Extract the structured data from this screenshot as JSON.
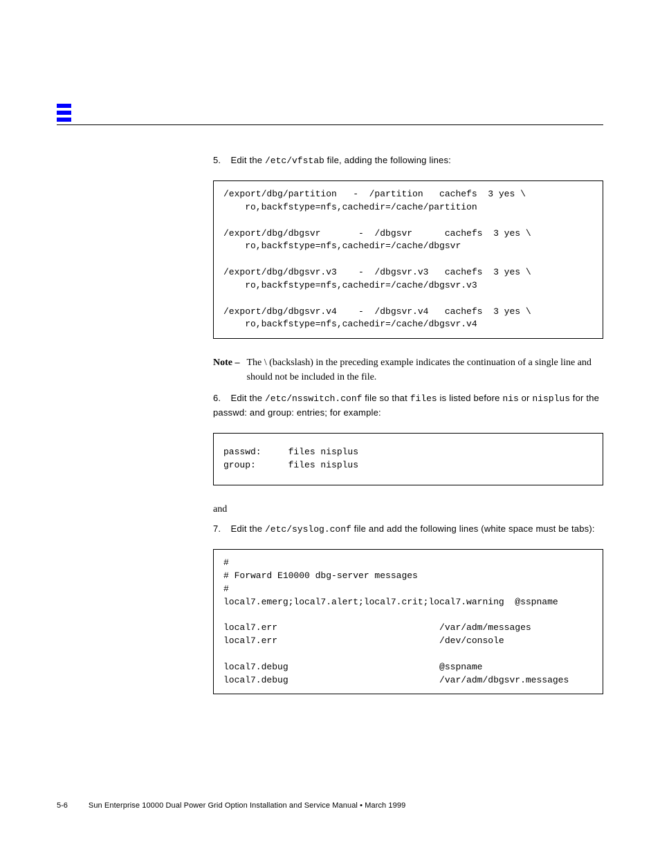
{
  "steps": {
    "s5": {
      "num": "5.",
      "pre": "Edit the ",
      "code": "/etc/vfstab",
      "post": " file, adding the following lines:"
    },
    "s6": {
      "num": "6.",
      "pre": "Edit the ",
      "code": "/etc/nsswitch.conf",
      "mid": " file so that ",
      "code2": "files",
      "mid2": " is listed before ",
      "code3": "nis",
      "mid3": " or ",
      "code4": "nisplus",
      "post": " for the passwd: and group: entries; for example:"
    },
    "s7": {
      "num": "7.",
      "pre": "Edit the ",
      "code": "/etc/syslog.conf",
      "post": " file and add the following lines (white space must be tabs):"
    }
  },
  "codebox1": "/export/dbg/partition   -  /partition   cachefs  3 yes \\\n    ro,backfstype=nfs,cachedir=/cache/partition\n\n/export/dbg/dbgsvr       -  /dbgsvr      cachefs  3 yes \\\n    ro,backfstype=nfs,cachedir=/cache/dbgsvr\n\n/export/dbg/dbgsvr.v3    -  /dbgsvr.v3   cachefs  3 yes \\\n    ro,backfstype=nfs,cachedir=/cache/dbgsvr.v3\n\n/export/dbg/dbgsvr.v4    -  /dbgsvr.v4   cachefs  3 yes \\\n    ro,backfstype=nfs,cachedir=/cache/dbgsvr.v4",
  "codebox2": "passwd:     files nisplus\ngroup:      files nisplus",
  "codebox3": "#\n# Forward E10000 dbg-server messages\n#\nlocal7.emerg;local7.alert;local7.crit;local7.warning  @sspname\n\nlocal7.err                              /var/adm/messages\nlocal7.err                              /dev/console\n\nlocal7.debug                            @sspname\nlocal7.debug                            /var/adm/dbgsvr.messages",
  "between": {
    "note_label": "Note –",
    "note_text": "The \\ (backslash) in the preceding example indicates the continuation of a single line and should not be included in the file.",
    "and": "and"
  },
  "footer": {
    "page": "5-6",
    "text": "Sun Enterprise 10000 Dual Power Grid Option Installation and Service Manual • March 1999"
  }
}
